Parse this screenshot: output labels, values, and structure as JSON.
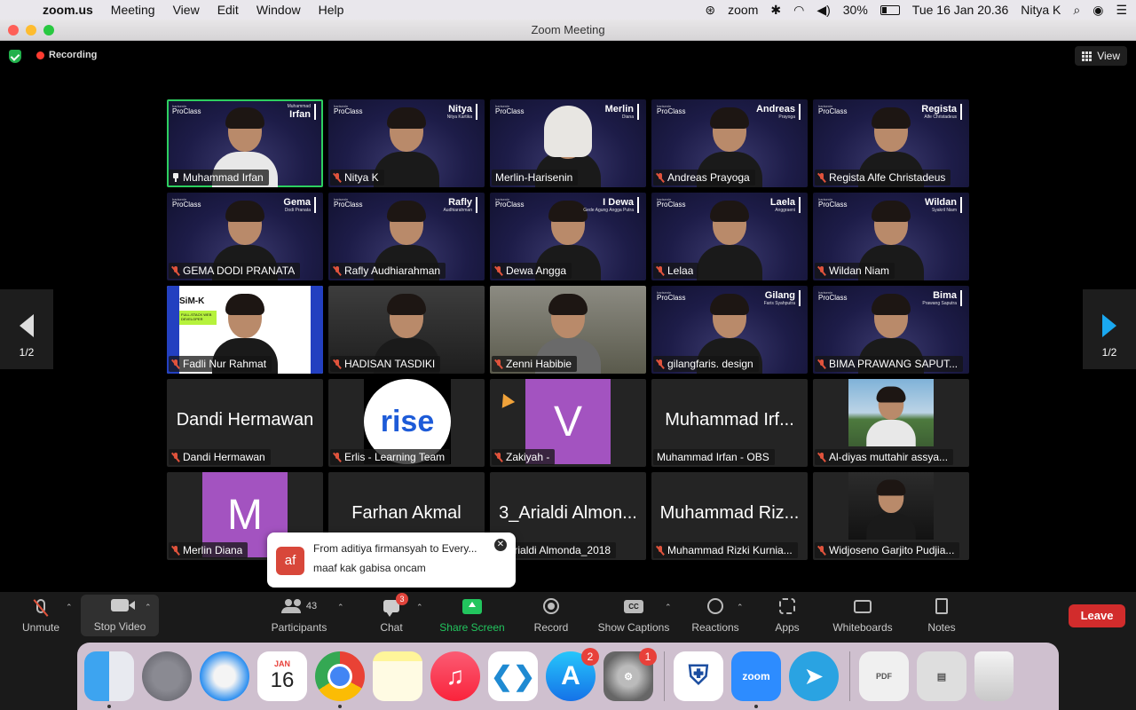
{
  "menubar": {
    "app": "zoom.us",
    "items": [
      "Meeting",
      "View",
      "Edit",
      "Window",
      "Help"
    ],
    "status_app": "zoom",
    "battery": "30%",
    "battery_level": 0.3,
    "datetime": "Tue 16 Jan  20.36",
    "user": "Nitya K"
  },
  "window": {
    "title": "Zoom Meeting"
  },
  "meeting": {
    "recording": "Recording",
    "view": "View",
    "page_left": "1/2",
    "page_right": "1/2",
    "tiles": [
      {
        "label": "Muhammad Irfan",
        "overlay_name": "Irfan",
        "overlay_first": "Muhammad",
        "active": true,
        "pinned": true,
        "kind": "proclass"
      },
      {
        "label": "Nitya K",
        "overlay_name": "Nitya",
        "overlay_sub": "Nitya Kartika",
        "kind": "proclass",
        "muted": true
      },
      {
        "label": "Merlin-Harisenin",
        "overlay_name": "Merlin",
        "overlay_sub": "Diana",
        "kind": "proclass",
        "hijab": true
      },
      {
        "label": "Andreas Prayoga",
        "overlay_name": "Andreas",
        "overlay_sub": "Prayoga",
        "kind": "proclass",
        "muted": true
      },
      {
        "label": "Regista Alfe Christadeus",
        "overlay_name": "Regista",
        "overlay_sub": "Alfe Christadeus",
        "kind": "proclass",
        "muted": true
      },
      {
        "label": "GEMA DODI PRANATA",
        "overlay_name": "Gema",
        "overlay_sub": "Dodi Pranata",
        "kind": "proclass",
        "muted": true
      },
      {
        "label": "Rafly Audhiarahman",
        "overlay_name": "Rafly",
        "overlay_sub": "Audhiarahman",
        "kind": "proclass",
        "muted": true
      },
      {
        "label": "Dewa Angga",
        "overlay_name": "I Dewa",
        "overlay_sub": "Gede Agung Angga Putra",
        "kind": "proclass",
        "muted": true
      },
      {
        "label": "Lelaa",
        "overlay_name": "Laela",
        "overlay_sub": "Anggraeni",
        "kind": "proclass",
        "muted": true
      },
      {
        "label": "Wildan Niam",
        "overlay_name": "Wildan",
        "overlay_sub": "Syakril Niam",
        "kind": "proclass",
        "muted": true
      },
      {
        "label": "Fadli Nur Rahmat",
        "kind": "simk",
        "simk_logo": "SiM-K",
        "simk_tag": "FULL-STACK WEB DEVELOPER",
        "muted": true
      },
      {
        "label": "HADISAN TASDIKI",
        "kind": "dark-room",
        "muted": true
      },
      {
        "label": "Zenni Habibie",
        "kind": "light-room",
        "muted": true
      },
      {
        "label": "gilangfaris. design",
        "overlay_name": "Gilang",
        "overlay_sub": "Faris Syahputra",
        "kind": "proclass-room",
        "muted": true
      },
      {
        "label": "BIMA PRAWANG SAPUT...",
        "overlay_name": "Bima",
        "overlay_sub": "Prawang Saputra",
        "kind": "proclass",
        "muted": true
      },
      {
        "label": "Dandi Hermawan",
        "center": "Dandi Hermawan",
        "kind": "name",
        "muted": true
      },
      {
        "label": "Erlis - Learning Team",
        "kind": "rise",
        "rise_text": "rise",
        "muted": true
      },
      {
        "label": "Zakiyah -",
        "kind": "avatar",
        "letter": "V",
        "muted": true,
        "hand": true
      },
      {
        "label": "Muhammad Irfan - OBS",
        "center": "Muhammad Irf...",
        "kind": "name"
      },
      {
        "label": "Al-diyas muttahir assya...",
        "kind": "photo-sky",
        "muted": true
      },
      {
        "label": "Merlin Diana",
        "kind": "avatar",
        "letter": "M",
        "muted": true
      },
      {
        "label": "",
        "center": "Farhan Akmal",
        "kind": "name"
      },
      {
        "label": "3_Arialdi Almonda_2018",
        "center": "3_Arialdi Almon...",
        "kind": "name"
      },
      {
        "label": "Muhammad Rizki Kurnia...",
        "center": "Muhammad Riz...",
        "kind": "name",
        "muted": true
      },
      {
        "label": "Widjoseno Garjito Pudjia...",
        "kind": "photo-studio",
        "muted": true
      }
    ],
    "brand_top": "harisenin",
    "brand_main": "ProClass"
  },
  "notification": {
    "avatar": "af",
    "from": "From aditiya firmansyah to Every...",
    "message": "maaf kak gabisa oncam",
    "close": "✕"
  },
  "toolbar": {
    "unmute": "Unmute",
    "stop_video": "Stop Video",
    "participants": "Participants",
    "participant_count": "43",
    "chat": "Chat",
    "chat_badge": "3",
    "share": "Share Screen",
    "record": "Record",
    "captions": "Show Captions",
    "cc": "CC",
    "reactions": "Reactions",
    "apps": "Apps",
    "whiteboards": "Whiteboards",
    "notes": "Notes",
    "leave": "Leave"
  },
  "dock": {
    "calendar_month": "JAN",
    "calendar_day": "16",
    "appstore_badge": "2",
    "prefs_badge": "1",
    "zoom_label": "zoom",
    "doc_label": "PDF"
  }
}
